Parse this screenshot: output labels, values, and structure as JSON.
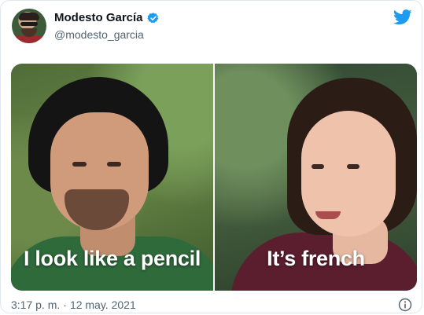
{
  "tweet": {
    "display_name": "Modesto García",
    "handle": "@modesto_garcia",
    "verified": true,
    "brand_icon": "twitter-bird-icon",
    "brand_color": "#1d9bf0",
    "media": {
      "left_caption": "I look like a pencil",
      "right_caption": "It’s french"
    },
    "time": "3:17 p. m.",
    "separator": "·",
    "date": "12 may. 2021",
    "info_icon": "info-icon"
  }
}
